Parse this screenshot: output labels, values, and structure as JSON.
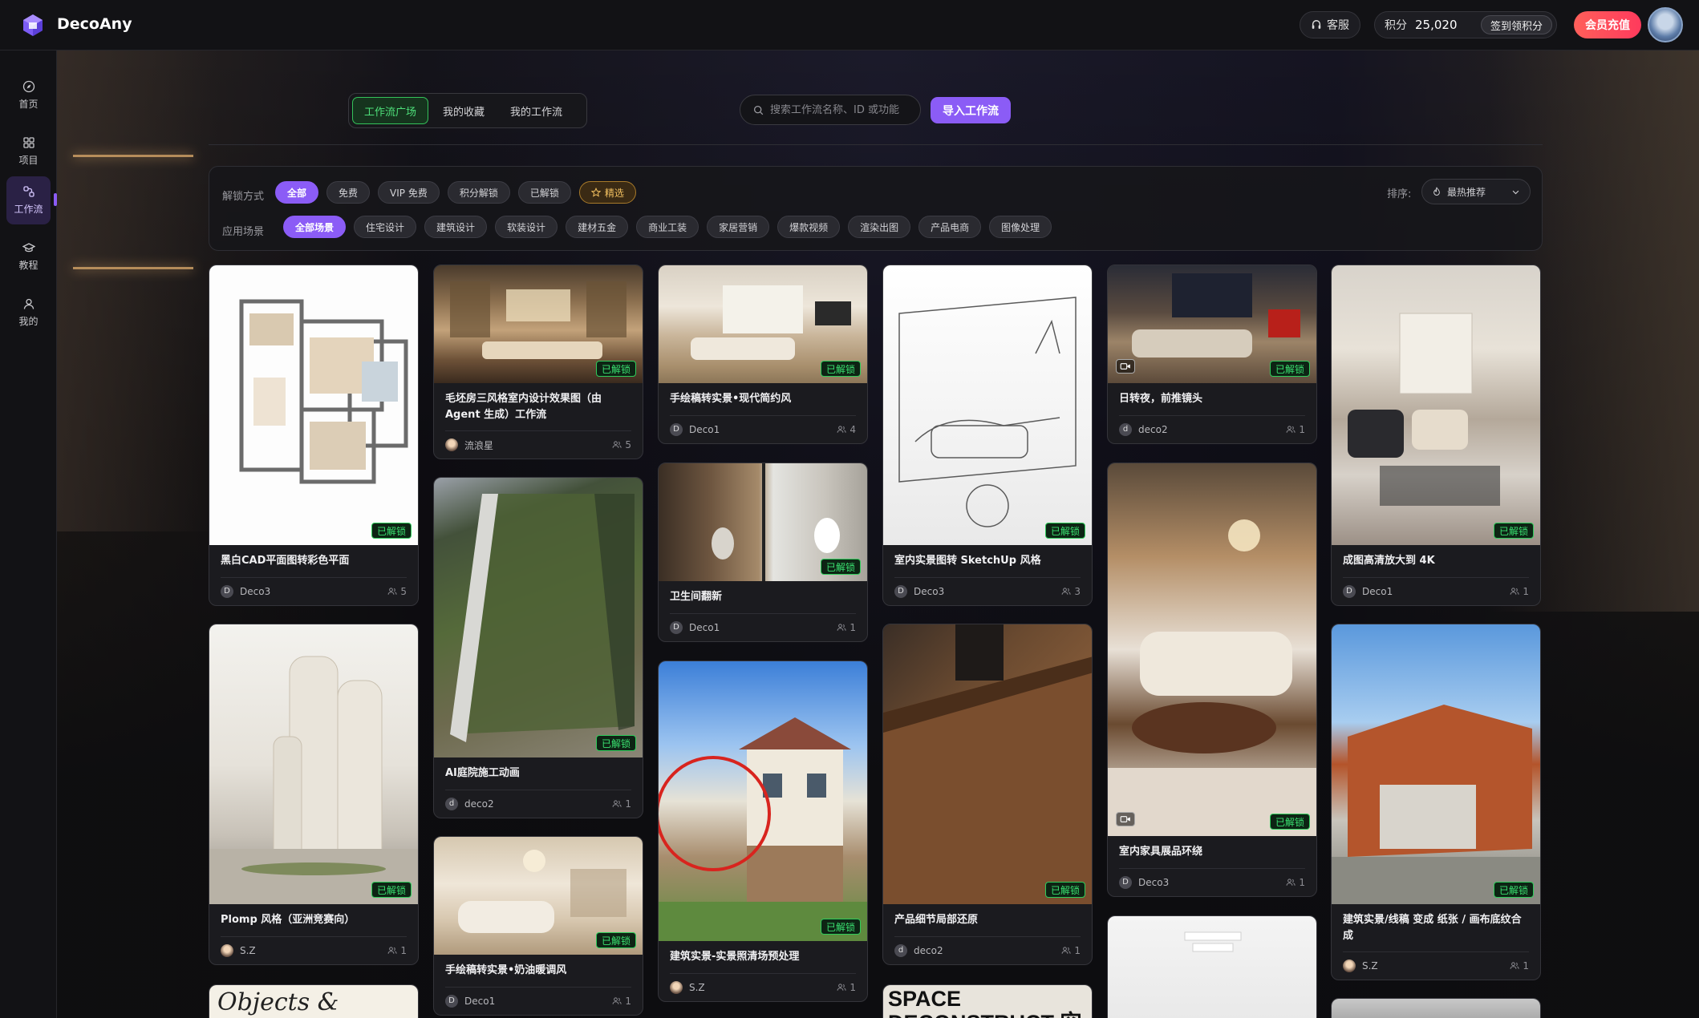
{
  "brand": {
    "name": "DecoAny"
  },
  "topbar": {
    "service_label": "客服",
    "points_label": "积分",
    "points_value": "25,020",
    "checkin_label": "签到领积分",
    "vip_label": "会员充值"
  },
  "sidebar": {
    "items": [
      {
        "label": "首页",
        "icon": "compass-icon"
      },
      {
        "label": "项目",
        "icon": "grid-icon"
      },
      {
        "label": "工作流",
        "icon": "workflow-icon",
        "active": true
      },
      {
        "label": "教程",
        "icon": "graduation-cap-icon"
      },
      {
        "label": "我的",
        "icon": "user-icon"
      }
    ]
  },
  "tabs": [
    {
      "label": "工作流广场",
      "active": true
    },
    {
      "label": "我的收藏"
    },
    {
      "label": "我的工作流"
    }
  ],
  "search": {
    "placeholder": "搜索工作流名称、ID 或功能"
  },
  "import_label": "导入工作流",
  "filters": {
    "unlock_label": "解锁方式",
    "unlock_options": [
      "全部",
      "免费",
      "VIP 免费",
      "积分解锁",
      "已解锁",
      "精选"
    ],
    "scene_label": "应用场景",
    "scene_options": [
      "全部场景",
      "住宅设计",
      "建筑设计",
      "软装设计",
      "建材五金",
      "商业工装",
      "家居营销",
      "爆款视频",
      "渲染出图",
      "产品电商",
      "图像处理"
    ],
    "sort_label": "排序:",
    "sort_value": "最热推荐"
  },
  "badge_label": "已解锁",
  "cards": [
    {
      "title": "黑白CAD平面图转彩色平面",
      "author": "Deco3",
      "avatar": "D",
      "uses": "5"
    },
    {
      "title": "Plomp 风格（亚洲竞赛向）",
      "author": "S.Z",
      "avatar": "",
      "uses": "1"
    },
    {
      "title": "Objects & Lamps"
    },
    {
      "title": "毛坯房三风格室内设计效果图（由 Agent 生成）工作流",
      "author": "流浪星",
      "avatar": "",
      "uses": "5"
    },
    {
      "title": "AI庭院施工动画",
      "author": "deco2",
      "avatar": "d",
      "uses": "1"
    },
    {
      "title": "手绘稿转实景•奶油暖调风",
      "author": "Deco1",
      "avatar": "D",
      "uses": "1"
    },
    {
      "title": "手绘稿转实景•现代简约风",
      "author": "Deco1",
      "avatar": "D",
      "uses": "4"
    },
    {
      "title": "卫生间翻新",
      "author": "Deco1",
      "avatar": "D",
      "uses": "1"
    },
    {
      "title": "建筑实景-实景照清场预处理",
      "author": "S.Z",
      "avatar": "",
      "uses": "1"
    },
    {
      "title": "室内实景图转 SketchUp 风格",
      "author": "Deco3",
      "avatar": "D",
      "uses": "3"
    },
    {
      "title": "产品细节局部还原",
      "author": "deco2",
      "avatar": "d",
      "uses": "1"
    },
    {
      "title": "SPACE DECONSTRUCT 空间解构"
    },
    {
      "title": "日转夜，前推镜头",
      "author": "deco2",
      "avatar": "d",
      "uses": "1"
    },
    {
      "title": "室内家具展品环绕",
      "author": "Deco3",
      "avatar": "D",
      "uses": "1"
    },
    {
      "title": "成图高清放大到 4K",
      "author": "Deco1",
      "avatar": "D",
      "uses": "1"
    },
    {
      "title": "建筑实景/线稿 变成 纸张 / 画布底纹合成",
      "author": "S.Z",
      "avatar": "",
      "uses": "1"
    }
  ]
}
